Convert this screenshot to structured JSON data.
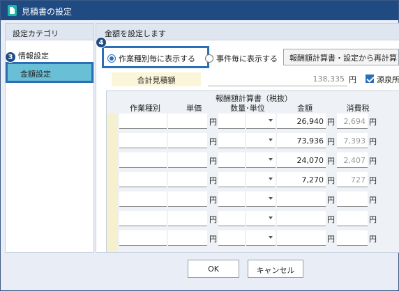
{
  "window": {
    "title": "見積書の設定"
  },
  "left_panel": {
    "header": "設定カテゴリ",
    "items": [
      {
        "label": "情報設定"
      },
      {
        "label": "金額設定"
      }
    ]
  },
  "right_panel": {
    "header": "金額を設定します",
    "radio_options": [
      {
        "label": "作業種別毎に表示する",
        "selected": true
      },
      {
        "label": "事件毎に表示する",
        "selected": false
      }
    ],
    "recalc_button": "報酬額計算書・設定から再計算",
    "total_label": "合計見積額",
    "total_value": "138,335",
    "currency": "円",
    "gensen_label": "源泉所",
    "gensen_checked": true
  },
  "grid": {
    "title": "報酬額計算書（税抜）",
    "columns": [
      "作業種別",
      "単価",
      "数量･単位",
      "金額",
      "消費税"
    ],
    "rows": [
      {
        "amount": "26,940",
        "tax": "2,694"
      },
      {
        "amount": "73,936",
        "tax": "7,393"
      },
      {
        "amount": "24,070",
        "tax": "2,407"
      },
      {
        "amount": "7,270",
        "tax": "727"
      },
      {
        "amount": "",
        "tax": ""
      },
      {
        "amount": "",
        "tax": ""
      },
      {
        "amount": "",
        "tax": ""
      }
    ]
  },
  "footer": {
    "ok": "OK",
    "cancel": "キャンセル"
  },
  "annotations": [
    "3",
    "4"
  ],
  "colors": {
    "titlebar": "#1f4a82",
    "selected_item": "#69c0d6",
    "focus_border": "#2a6fb7"
  }
}
